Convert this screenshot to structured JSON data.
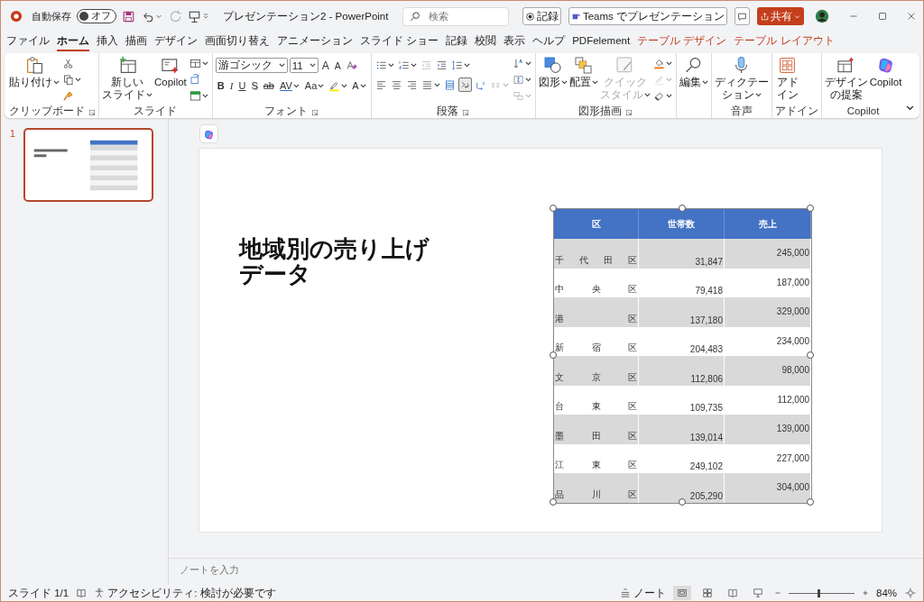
{
  "title_bar": {
    "autosave_label": "自動保存",
    "autosave": {
      "on": false,
      "label": "オフ"
    },
    "document_title": "プレゼンテーション2 - PowerPoint",
    "search": {
      "placeholder": "検索"
    }
  },
  "tabs": [
    {
      "label": "ファイル",
      "selected": false,
      "contextual": false
    },
    {
      "label": "ホーム",
      "selected": true,
      "contextual": false
    },
    {
      "label": "挿入",
      "selected": false,
      "contextual": false
    },
    {
      "label": "描画",
      "selected": false,
      "contextual": false
    },
    {
      "label": "デザイン",
      "selected": false,
      "contextual": false
    },
    {
      "label": "画面切り替え",
      "selected": false,
      "contextual": false
    },
    {
      "label": "アニメーション",
      "selected": false,
      "contextual": false
    },
    {
      "label": "スライド ショー",
      "selected": false,
      "contextual": false
    },
    {
      "label": "記録",
      "selected": false,
      "contextual": false
    },
    {
      "label": "校閲",
      "selected": false,
      "contextual": false
    },
    {
      "label": "表示",
      "selected": false,
      "contextual": false
    },
    {
      "label": "ヘルプ",
      "selected": false,
      "contextual": false
    },
    {
      "label": "PDFelement",
      "selected": false,
      "contextual": false
    },
    {
      "label": "テーブル デザイン",
      "selected": false,
      "contextual": true
    },
    {
      "label": "テーブル レイアウト",
      "selected": false,
      "contextual": true
    }
  ],
  "actions": {
    "record": "記録",
    "teams": "Teams でプレゼンテーション",
    "share": "共有"
  },
  "ribbon": {
    "groups": [
      {
        "label": "クリップボード",
        "launcher": true,
        "large": [
          {
            "lines": [
              "貼り付け"
            ],
            "dropdown": true
          }
        ],
        "small": [
          {
            "kind": "icon"
          },
          {
            "kind": "icon",
            "dropdown": true
          },
          {
            "kind": "icon"
          }
        ]
      },
      {
        "label": "スライド",
        "large": [
          {
            "lines": [
              "新しい",
              "スライド"
            ],
            "dropdown": true
          },
          {
            "lines": [
              "Copilot"
            ]
          }
        ],
        "small": [
          {
            "kind": "icon",
            "dropdown": true
          },
          {
            "kind": "icon"
          },
          {
            "kind": "icon",
            "dropdown": true
          }
        ]
      },
      {
        "label": "フォント",
        "launcher": true,
        "top_row": [
          {
            "kind": "field",
            "value": "游ゴシック",
            "dropdown": true
          },
          {
            "kind": "field",
            "value": "11",
            "dropdown": true
          },
          {
            "kind": "text",
            "label": "A"
          },
          {
            "kind": "text",
            "label": "A"
          },
          {
            "kind": "icon"
          }
        ],
        "bottom_row": [
          {
            "kind": "text",
            "label": "B"
          },
          {
            "kind": "text",
            "label": "I"
          },
          {
            "kind": "text",
            "label": "U"
          },
          {
            "kind": "text",
            "label": "S"
          },
          {
            "kind": "text",
            "label": "ab"
          },
          {
            "kind": "text",
            "label": "AV",
            "dropdown": true
          },
          {
            "kind": "text",
            "label": "Aa",
            "dropdown": true
          },
          {
            "kind": "icon",
            "dropdown": true
          },
          {
            "kind": "text",
            "label": "A",
            "dropdown": true
          }
        ]
      },
      {
        "label": "段落",
        "launcher": true,
        "top_row": [
          {
            "kind": "icon",
            "dropdown": true
          },
          {
            "kind": "icon",
            "dropdown": true
          },
          {
            "kind": "icon",
            "disabled": true
          },
          {
            "kind": "icon"
          },
          {
            "kind": "icon",
            "dropdown": true
          }
        ],
        "bottom_row": [
          {
            "kind": "icon"
          },
          {
            "kind": "icon"
          },
          {
            "kind": "icon"
          },
          {
            "kind": "icon",
            "dropdown": true
          },
          {
            "kind": "icon"
          },
          {
            "kind": "icon",
            "on": true
          },
          {
            "kind": "icon"
          },
          {
            "kind": "icon",
            "dropdown": true,
            "disabled": true
          }
        ],
        "small": [
          {
            "kind": "icon",
            "dropdown": true
          },
          {
            "kind": "icon",
            "dropdown": true
          },
          {
            "kind": "icon",
            "dropdown": true,
            "disabled": true
          }
        ]
      },
      {
        "label": "図形描画",
        "launcher": true,
        "large": [
          {
            "lines": [
              "図形"
            ],
            "dropdown": true
          },
          {
            "lines": [
              "配置"
            ],
            "dropdown": true
          },
          {
            "lines": [
              "クイック",
              "スタイル"
            ],
            "dropdown": true,
            "disabled": true
          }
        ],
        "small": [
          {
            "kind": "icon",
            "dropdown": true
          },
          {
            "kind": "icon",
            "dropdown": true,
            "disabled": true
          },
          {
            "kind": "icon",
            "dropdown": true
          }
        ]
      },
      {
        "large": [
          {
            "lines": [
              "編集"
            ],
            "dropdown": true
          }
        ]
      },
      {
        "label": "音声",
        "large": [
          {
            "lines": [
              "ディクテー",
              "ション"
            ],
            "dropdown": true
          }
        ]
      },
      {
        "label": "アドイン",
        "large": [
          {
            "lines": [
              "アド",
              "イン"
            ]
          }
        ]
      },
      {
        "label": "Copilot",
        "large": [
          {
            "lines": [
              "デザイン",
              "の提案"
            ]
          },
          {
            "lines": [
              "Copilot"
            ]
          }
        ]
      }
    ]
  },
  "slides_pane": {
    "slides": [
      {
        "number": "1",
        "selected": true
      }
    ]
  },
  "slide": {
    "title": "地域別の売り上げデータ",
    "table": {
      "columns": [
        "区",
        "世帯数",
        "売上"
      ],
      "rows": [
        {
          "ward": "千代田区",
          "households": "31,847",
          "sales": "245,000"
        },
        {
          "ward": "中央区",
          "households": "79,418",
          "sales": "187,000"
        },
        {
          "ward": "港区",
          "households": "137,180",
          "sales": "329,000"
        },
        {
          "ward": "新宿区",
          "households": "204,483",
          "sales": "234,000"
        },
        {
          "ward": "文京区",
          "households": "112,806",
          "sales": "98,000"
        },
        {
          "ward": "台東区",
          "households": "109,735",
          "sales": "112,000"
        },
        {
          "ward": "墨田区",
          "households": "139,014",
          "sales": "139,000"
        },
        {
          "ward": "江東区",
          "households": "249,102",
          "sales": "227,000"
        },
        {
          "ward": "品川区",
          "households": "205,290",
          "sales": "304,000"
        }
      ]
    }
  },
  "notes": {
    "placeholder": "ノートを入力"
  },
  "status_bar": {
    "slide_counter": "スライド 1/1",
    "accessibility": "アクセシビリティ: 検討が必要です",
    "notes_button": "ノート",
    "views": [
      {
        "selected": true
      },
      {
        "selected": false
      },
      {
        "selected": false
      },
      {
        "selected": false
      }
    ],
    "zoom": {
      "level": 0.45,
      "label": "84%"
    }
  }
}
